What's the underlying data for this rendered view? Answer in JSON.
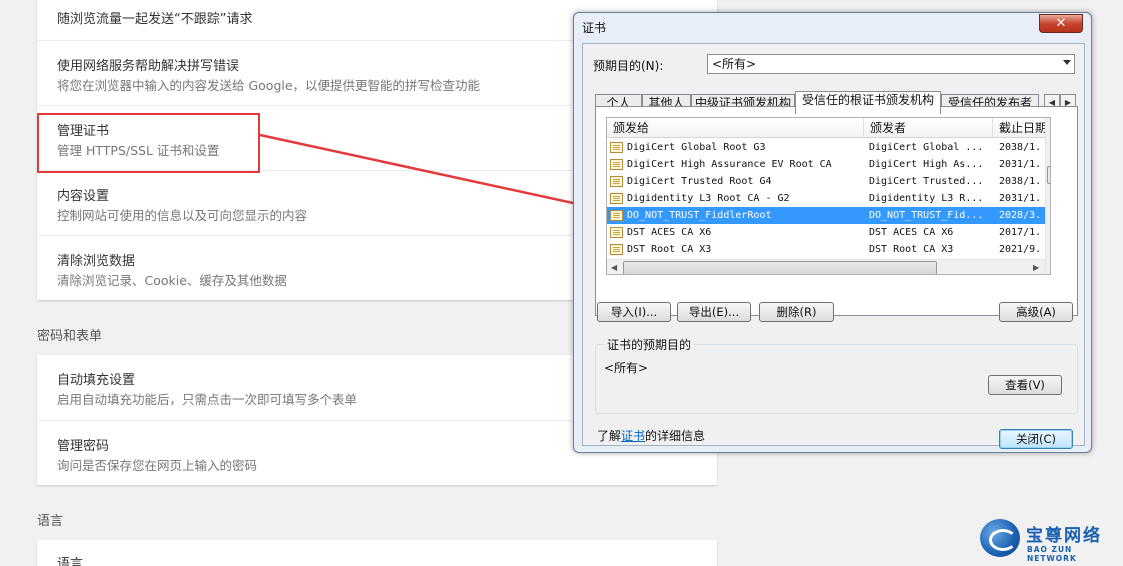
{
  "settings": {
    "rows_top": [
      {
        "title": "随浏览流量一起发送“不跟踪”请求",
        "subtitle": ""
      },
      {
        "title": "使用网络服务帮助解决拼写错误",
        "subtitle": "将您在浏览器中输入的内容发送给 Google，以便提供更智能的拼写检查功能"
      },
      {
        "title": "管理证书",
        "subtitle": "管理 HTTPS/SSL 证书和设置"
      },
      {
        "title": "内容设置",
        "subtitle": "控制网站可使用的信息以及可向您显示的内容"
      },
      {
        "title": "清除浏览数据",
        "subtitle": "清除浏览记录、Cookie、缓存及其他数据"
      }
    ],
    "section_passwords": "密码和表单",
    "rows_passwords": [
      {
        "title": "自动填充设置",
        "subtitle": "启用自动填充功能后，只需点击一次即可填写多个表单"
      },
      {
        "title": "管理密码",
        "subtitle": "询问是否保存您在网页上输入的密码"
      }
    ],
    "section_language": "语言",
    "rows_language": [
      {
        "title": "语言"
      }
    ]
  },
  "dialog": {
    "title": "证书",
    "close_glyph": "✕",
    "purpose_label": "预期目的(N):",
    "purpose_value": "<所有>",
    "tabs": [
      "个人",
      "其他人",
      "中级证书颁发机构",
      "受信任的根证书颁发机构",
      "受信任的发布者"
    ],
    "tab_scroll_left": "◀",
    "tab_scroll_right": "▶",
    "columns": [
      "颁发给",
      "颁发者",
      "截止日期"
    ],
    "rows": [
      {
        "issued_to": "DigiCert Global Root G3",
        "issued_by": "DigiCert Global ...",
        "expires": "2038/1."
      },
      {
        "issued_to": "DigiCert High Assurance EV Root CA",
        "issued_by": "DigiCert High As...",
        "expires": "2031/1."
      },
      {
        "issued_to": "DigiCert Trusted Root G4",
        "issued_by": "DigiCert Trusted...",
        "expires": "2038/1."
      },
      {
        "issued_to": "Digidentity L3 Root CA - G2",
        "issued_by": "Digidentity L3 R...",
        "expires": "2031/1."
      },
      {
        "issued_to": "DO_NOT_TRUST_FiddlerRoot",
        "issued_by": "DO_NOT_TRUST_Fid...",
        "expires": "2028/3."
      },
      {
        "issued_to": "DST ACES CA X6",
        "issued_by": "DST ACES CA X6",
        "expires": "2017/1."
      },
      {
        "issued_to": "DST Root CA X3",
        "issued_by": "DST Root CA X3",
        "expires": "2021/9."
      }
    ],
    "selected_index": 4,
    "buttons": {
      "import": "导入(I)...",
      "export": "导出(E)...",
      "remove": "删除(R)",
      "advanced": "高级(A)",
      "view": "查看(V)",
      "close": "关闭(C)"
    },
    "purposes_group_title": "证书的预期目的",
    "purposes_value": "<所有>",
    "learn_prefix": "了解",
    "learn_link": "证书",
    "learn_suffix": "的详细信息"
  },
  "logo": {
    "cn": "宝尊网络",
    "en": "BAO ZUN NETWORK"
  },
  "colors": {
    "highlight": "#e53a3a",
    "selection": "#3399ff",
    "brand": "#1a5fb0"
  }
}
